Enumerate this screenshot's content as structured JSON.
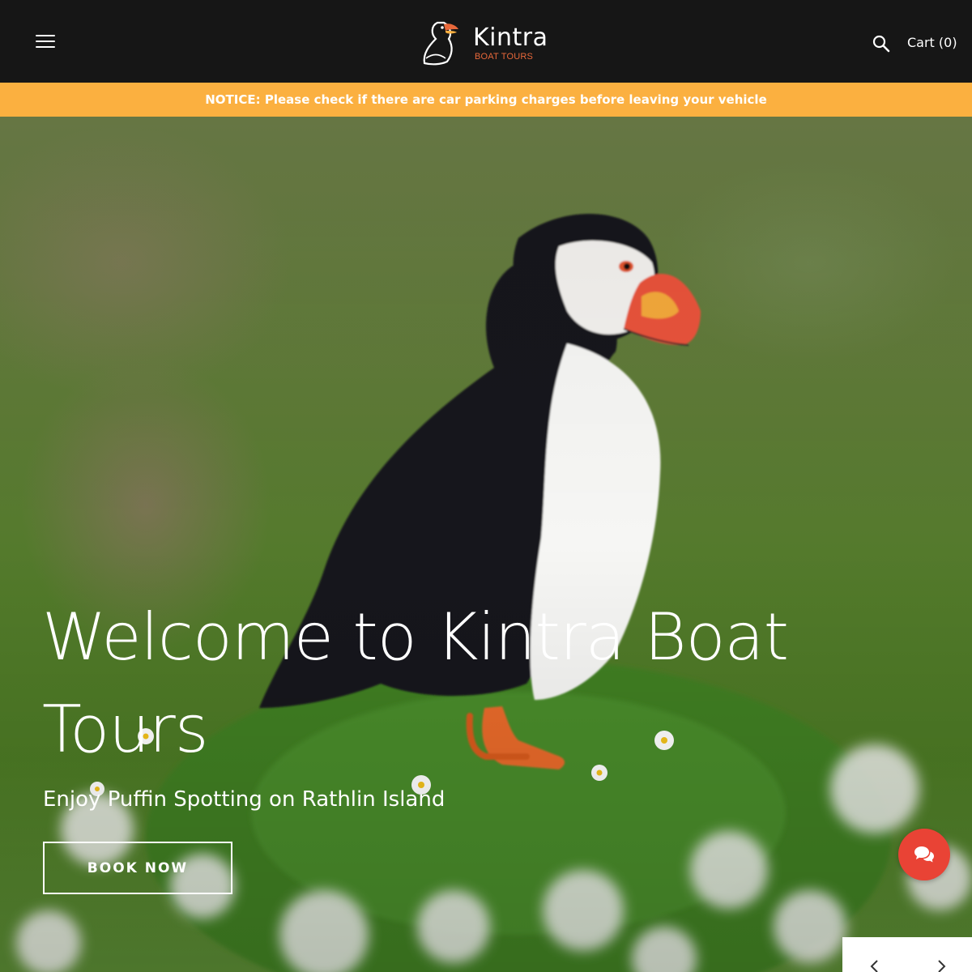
{
  "header": {
    "menu_icon": "hamburger-menu-icon",
    "brand_name": "Kintra",
    "brand_sub": "BOAT TOURS",
    "search_icon": "search-icon",
    "cart_label": "Cart (0)"
  },
  "notice": {
    "text": "NOTICE: Please check if there are car parking charges before leaving your vehicle",
    "color": "#fbb040"
  },
  "hero": {
    "title": "Welcome to Kintra Boat Tours",
    "subtitle": "Enjoy Puffin Spotting on Rathlin Island",
    "cta_label": "BOOK NOW"
  },
  "chat": {
    "icon": "chat-bubbles-icon",
    "color": "#e94335"
  },
  "slider": {
    "prev_icon": "chevron-left-icon",
    "next_icon": "chevron-right-icon"
  },
  "colors": {
    "header_bg": "#161616",
    "accent": "#e8683a"
  }
}
